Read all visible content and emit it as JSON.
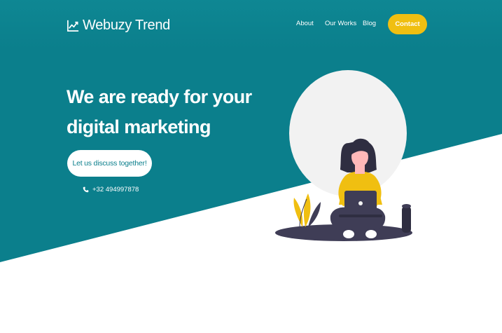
{
  "colors": {
    "primary": "#0b7f8c",
    "accent": "#f0bf11",
    "white": "#ffffff",
    "illustration_bg": "#f2f2f2",
    "dark": "#3f3d56"
  },
  "brand": {
    "name": "Webuzy Trend",
    "icon": "trend-chart-icon"
  },
  "nav": {
    "items": [
      {
        "label": "About"
      },
      {
        "label": "Our Works"
      },
      {
        "label": "Blog"
      }
    ],
    "contact_label": "Contact"
  },
  "hero": {
    "headline_line1": "We are ready for your",
    "headline_line2": "digital marketing",
    "cta_label": "Let us discuss together!",
    "phone": "+32 494997878",
    "phone_icon": "phone-icon",
    "illustration": "woman-with-laptop-illustration"
  }
}
